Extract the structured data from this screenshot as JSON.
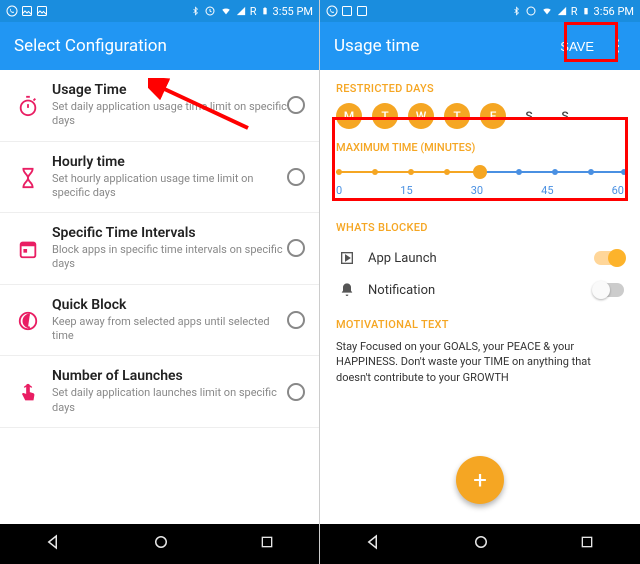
{
  "statusbar_left": {
    "time_l": "3:55 PM",
    "time_r": "3:56 PM",
    "net": "R"
  },
  "left": {
    "appbar_title": "Select Configuration",
    "items": [
      {
        "title": "Usage Time",
        "sub": "Set daily application usage time limit on specific days"
      },
      {
        "title": "Hourly time",
        "sub": "Set hourly application usage time limit on specific days"
      },
      {
        "title": "Specific Time Intervals",
        "sub": "Block apps in specific time intervals on specific days"
      },
      {
        "title": "Quick Block",
        "sub": "Keep away from selected apps until selected time"
      },
      {
        "title": "Number of Launches",
        "sub": "Set daily application launches limit on specific days"
      }
    ]
  },
  "right": {
    "appbar_title": "Usage time",
    "save": "SAVE",
    "restricted_header": "RESTRICTED DAYS",
    "days": [
      "M",
      "T",
      "W",
      "T",
      "F",
      "S",
      "S"
    ],
    "max_header": "MAXIMUM TIME (MINUTES)",
    "slider_labels": [
      "0",
      "15",
      "30",
      "45",
      "60"
    ],
    "slider_value": 30,
    "whats_header": "WHATS BLOCKED",
    "blocked": [
      {
        "label": "App Launch",
        "on": true
      },
      {
        "label": "Notification",
        "on": false
      }
    ],
    "mot_header": "MOTIVATIONAL TEXT",
    "mot_body": "Stay Focused on your GOALS, your PEACE & your HAPPINESS. Don't waste your TIME on anything that doesn't contribute to your GROWTH"
  }
}
